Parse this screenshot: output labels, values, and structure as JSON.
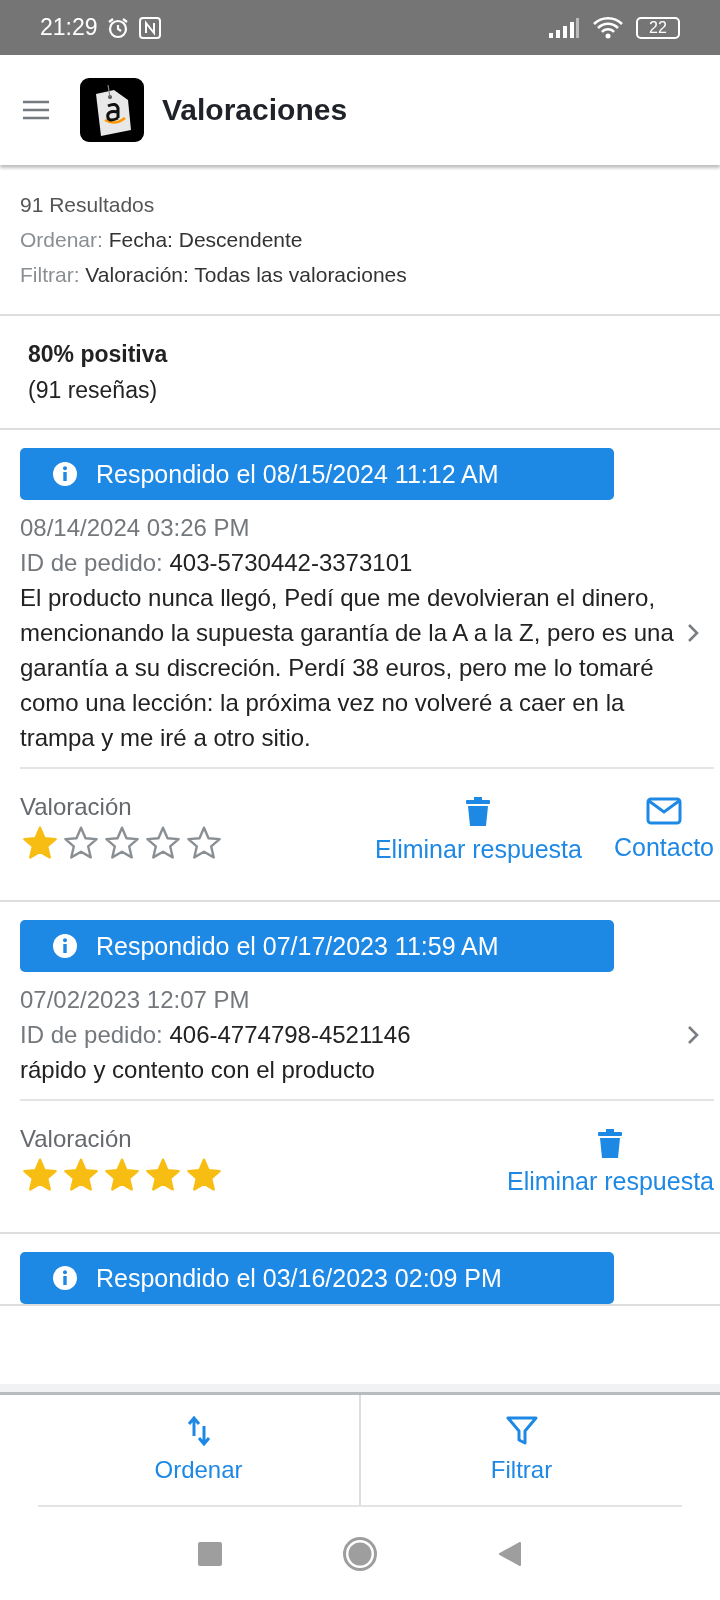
{
  "status_bar": {
    "time": "21:29",
    "battery": "22"
  },
  "header": {
    "title": "Valoraciones"
  },
  "summary": {
    "results": "91 Resultados",
    "sort_label": "Ordenar:",
    "sort_value": "Fecha: Descendente",
    "filter_label": "Filtrar:",
    "filter_value": "Valoración: Todas las valoraciones"
  },
  "rating_summary": {
    "percent": "80% positiva",
    "count": "(91 reseñas)"
  },
  "reviews": [
    {
      "responded": "Respondido el 08/15/2024 11:12 AM",
      "date": "08/14/2024 03:26 PM",
      "order_label": "ID de pedido:",
      "order_id": "403-5730442-3373101",
      "text": "El producto nunca llegó, Pedí que me devolvieran el dinero, mencionando la supuesta garantía de la A a la Z, pero es una garantía a su discreción. Perdí 38 euros, pero me lo tomaré como una lección: la próxima vez no volveré a caer en la trampa y me iré a otro sitio.",
      "rating_label": "Valoración",
      "stars": 1,
      "actions": [
        {
          "kind": "delete",
          "label": "Eliminar respuesta"
        },
        {
          "kind": "contact",
          "label": "Contacto"
        }
      ]
    },
    {
      "responded": "Respondido el 07/17/2023 11:59 AM",
      "date": "07/02/2023 12:07 PM",
      "order_label": "ID de pedido:",
      "order_id": "406-4774798-4521146",
      "text": "rápido y contento con el producto",
      "rating_label": "Valoración",
      "stars": 5,
      "actions": [
        {
          "kind": "delete",
          "label": "Eliminar respuesta"
        }
      ]
    },
    {
      "responded": "Respondido el 03/16/2023 02:09 PM"
    }
  ],
  "bottom_bar": [
    {
      "kind": "sort",
      "label": "Ordenar"
    },
    {
      "kind": "filter",
      "label": "Filtrar"
    }
  ]
}
